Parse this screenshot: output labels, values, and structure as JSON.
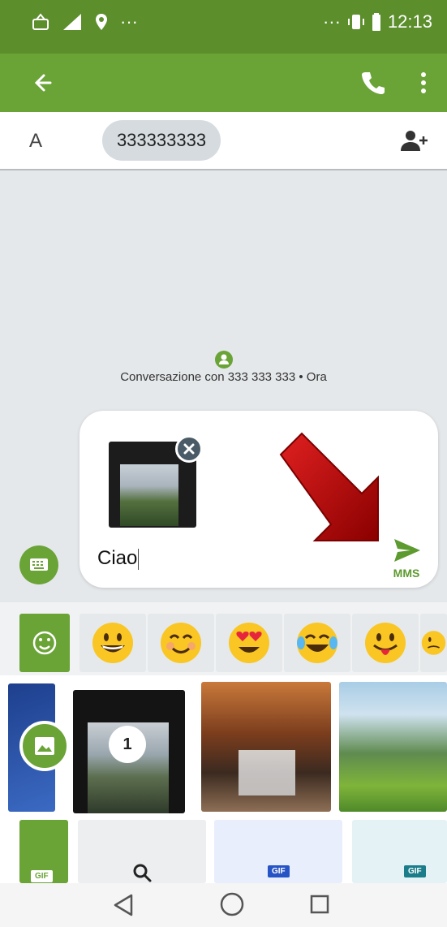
{
  "status_bar": {
    "time": "12:13",
    "network": "4G"
  },
  "recipient": {
    "to_label": "A",
    "number": "333333333"
  },
  "conversation": {
    "info_text": "Conversazione con 333 333 333 • Ora"
  },
  "compose": {
    "message_text": "Ciao",
    "send_label": "MMS",
    "attachment_count": 1
  },
  "gallery": {
    "selected_index": "1"
  },
  "bottom_tabs": {
    "gif_label": "GIF"
  },
  "colors": {
    "appbar": "#6aa336",
    "statusbar": "#5c8e2c",
    "accent": "#6aa336",
    "conversation_bg": "#e5e8ea"
  },
  "icons": {
    "appbar": [
      "back-arrow-icon",
      "phone-icon",
      "more-vert-icon"
    ],
    "compose": [
      "close-icon",
      "send-icon",
      "keyboard-icon"
    ],
    "emoji": [
      "smile-icon",
      "grin-emoji",
      "smiling-emoji",
      "heart-eyes-emoji",
      "tears-of-joy-emoji",
      "tongue-emoji",
      "confused-emoji"
    ],
    "nav": [
      "back-triangle-icon",
      "home-circle-icon",
      "recents-square-icon"
    ]
  }
}
